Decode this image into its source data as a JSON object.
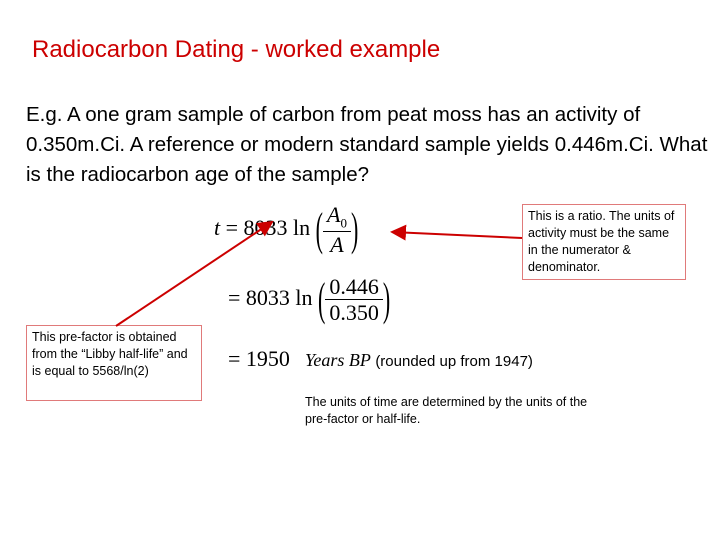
{
  "slide": {
    "title": "Radiocarbon Dating - worked example",
    "problem": "E.g.  A one gram sample of carbon from peat moss has an activity of 0.350m.Ci. A reference or modern standard sample yields 0.446m.Ci.  What is the radiocarbon age of the sample?"
  },
  "equation": {
    "line1_lhs": "t",
    "line1_eq": "= 8033 ln",
    "line1_num": "A",
    "line1_num_sub": "0",
    "line1_den": "A",
    "line2_eq": "= 8033 ln",
    "line2_num": "0.446",
    "line2_den": "0.350",
    "line3_eq": "= 1950",
    "line3_unit": "Years BP",
    "line3_note": "(rounded up from 1947)"
  },
  "callouts": {
    "ratio_note": "This is a ratio.  The units of activity must be the same in the numerator & denominator.",
    "prefactor_note": "This pre-factor is obtained from the “Libby half-life” and is equal to 5568/ln(2)",
    "units_note": "The units of time are determined by the units of the pre-factor or half-life."
  },
  "colors": {
    "title": "#cc0000",
    "arrow": "#cc0000",
    "box_border": "#e07a7a"
  }
}
